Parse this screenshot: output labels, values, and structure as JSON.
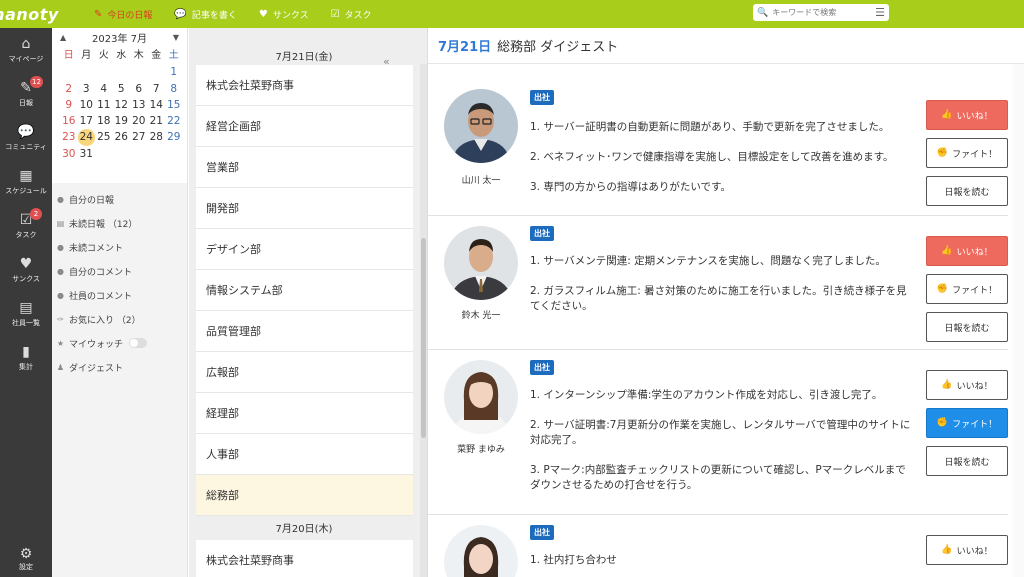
{
  "topbar": {
    "logo": "nanoty",
    "nav": [
      {
        "icon": "pencil-note-icon",
        "label": "今日の日報",
        "active": true
      },
      {
        "icon": "speech-bubbles-icon",
        "label": "記事を書く",
        "active": false
      },
      {
        "icon": "heart-icon",
        "label": "サンクス",
        "active": false
      },
      {
        "icon": "task-check-icon",
        "label": "タスク",
        "active": false
      }
    ],
    "search_placeholder": "キーワードで検索"
  },
  "sidenav": {
    "items": [
      {
        "icon": "home-icon",
        "label": "マイページ"
      },
      {
        "icon": "report-edit-icon",
        "label": "日報",
        "badge": "12"
      },
      {
        "icon": "community-icon",
        "label": "コミュニティ"
      },
      {
        "icon": "calendar-icon",
        "label": "スケジュール"
      },
      {
        "icon": "task-icon",
        "label": "タスク",
        "badge": "2"
      },
      {
        "icon": "heart-icon",
        "label": "サンクス"
      },
      {
        "icon": "employee-list-icon",
        "label": "社員一覧"
      },
      {
        "icon": "stats-icon",
        "label": "集計"
      }
    ],
    "settings_label": "設定"
  },
  "calendar": {
    "title": "2023年 7月",
    "weekdays": [
      "日",
      "月",
      "火",
      "水",
      "木",
      "金",
      "土"
    ],
    "weeks": [
      [
        "",
        "",
        "",
        "",
        "",
        "",
        "1"
      ],
      [
        "2",
        "3",
        "4",
        "5",
        "6",
        "7",
        "8"
      ],
      [
        "9",
        "10",
        "11",
        "12",
        "13",
        "14",
        "15"
      ],
      [
        "16",
        "17",
        "18",
        "19",
        "20",
        "21",
        "22"
      ],
      [
        "23",
        "24",
        "25",
        "26",
        "27",
        "28",
        "29"
      ],
      [
        "30",
        "31",
        "",
        "",
        "",
        "",
        ""
      ]
    ],
    "today": "24"
  },
  "leftmenu": {
    "items": [
      {
        "icon": "person-icon",
        "label": "自分の日報"
      },
      {
        "icon": "document-icon",
        "label": "未読日報 （12）"
      },
      {
        "icon": "comment-icon",
        "label": "未読コメント"
      },
      {
        "icon": "comment-icon",
        "label": "自分のコメント"
      },
      {
        "icon": "comment-icon",
        "label": "社員のコメント"
      },
      {
        "icon": "pin-icon",
        "label": "お気に入り （2）"
      },
      {
        "icon": "star-icon",
        "label": "マイウォッチ"
      },
      {
        "icon": "group-icon",
        "label": "ダイジェスト"
      }
    ]
  },
  "depts": {
    "day1_label": "7月21日(金)",
    "day1_items": [
      "株式会社菜野商事",
      "経営企画部",
      "営業部",
      "開発部",
      "デザイン部",
      "情報システム部",
      "品質管理部",
      "広報部",
      "経理部",
      "人事部",
      "総務部"
    ],
    "selected": "総務部",
    "day2_label": "7月20日(木)",
    "day2_items": [
      "株式会社菜野商事"
    ]
  },
  "main": {
    "date": "7月21日",
    "title": "総務部 ダイジェスト",
    "entries": [
      {
        "name": "山川 太一",
        "tag": "出社",
        "lines": [
          "1. サーバー証明書の自動更新に問題があり、手動で更新を完了させました。",
          "2. ベネフィット･ワンで健康指導を実施し、目標設定をして改善を進めます。",
          "3. 専門の方からの指導はありがたいです。"
        ],
        "liked": true,
        "fight": false
      },
      {
        "name": "鈴木 光一",
        "tag": "出社",
        "lines": [
          "1. サーバメンテ関連: 定期メンテナンスを実施し、問題なく完了しました。",
          "2. ガラスフィルム施工: 暑さ対策のために施工を行いました。引き続き様子を見てください。"
        ],
        "liked": true,
        "fight": false
      },
      {
        "name": "菜野 まゆみ",
        "tag": "出社",
        "lines": [
          "1. インターンシップ準備:学生のアカウント作成を対応し、引き渡し完了。",
          "2. サーバ証明書:7月更新分の作業を実施し、レンタルサーバで管理中のサイトに対応完了。",
          "3. Pマーク:内部監査チェックリストの更新について確認し、Pマークレベルまでダウンさせるための打合せを行う。"
        ],
        "liked": false,
        "fight": true
      },
      {
        "name": "",
        "tag": "出社",
        "lines": [
          "1. 社内打ち合わせ"
        ],
        "liked": false,
        "fight": false
      }
    ],
    "btn_like": "いいね！",
    "btn_fight": "ファイト！",
    "btn_read": "日報を読む"
  },
  "colors": {
    "brand_green": "#a8cd1b",
    "accent_blue": "#2f7ad6",
    "like_red": "#ef6a5e",
    "fight_blue": "#1f8ee8",
    "tag_blue": "#1c6bbd"
  }
}
